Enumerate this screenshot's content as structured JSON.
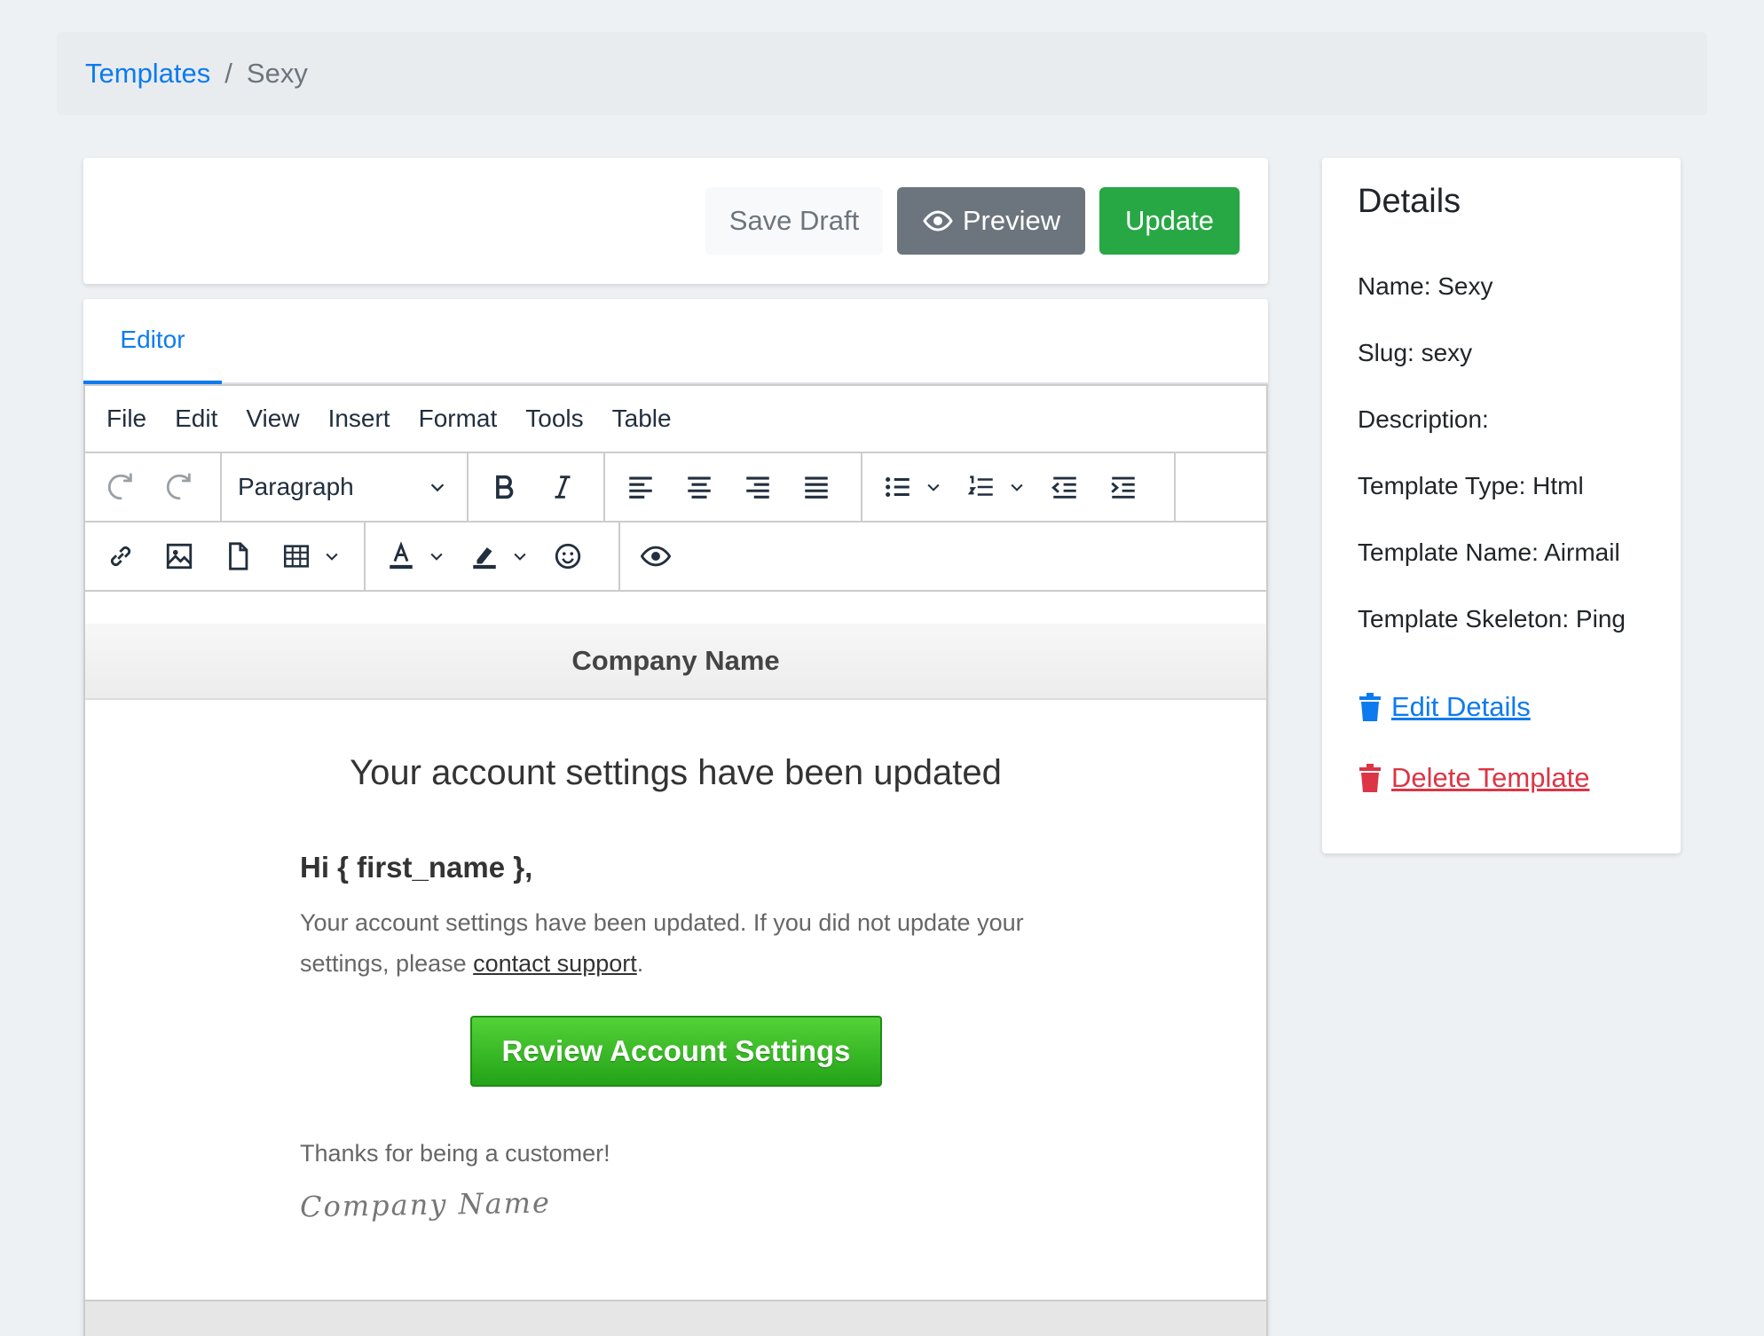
{
  "breadcrumb": {
    "parent": "Templates",
    "separator": "/",
    "current": "Sexy"
  },
  "actions": {
    "save_draft": "Save Draft",
    "preview": "Preview",
    "update": "Update"
  },
  "tabs": [
    {
      "label": "Editor"
    }
  ],
  "menubar": [
    "File",
    "Edit",
    "View",
    "Insert",
    "Format",
    "Tools",
    "Table"
  ],
  "toolbar": {
    "block_format": "Paragraph"
  },
  "email": {
    "header": "Company Name",
    "title": "Your account settings have been updated",
    "greeting": "Hi { first_name },",
    "body_before": "Your account settings have been updated. If you did not update your settings, please ",
    "body_link": "contact support",
    "body_after": ".",
    "cta": "Review Account Settings",
    "thanks": "Thanks for being a customer!",
    "signature": "Company Name"
  },
  "details": {
    "title": "Details",
    "rows": [
      {
        "key": "Name:",
        "value": "Sexy"
      },
      {
        "key": "Slug:",
        "value": "sexy"
      },
      {
        "key": "Description:",
        "value": ""
      },
      {
        "key": "Template Type:",
        "value": "Html"
      },
      {
        "key": "Template Name:",
        "value": "Airmail"
      },
      {
        "key": "Template Skeleton:",
        "value": "Ping"
      }
    ],
    "edit": "Edit Details",
    "delete": "Delete Template"
  },
  "colors": {
    "primary": "#0d7bef",
    "success": "#28a745",
    "secondary": "#6c757d",
    "danger": "#dc3545"
  }
}
